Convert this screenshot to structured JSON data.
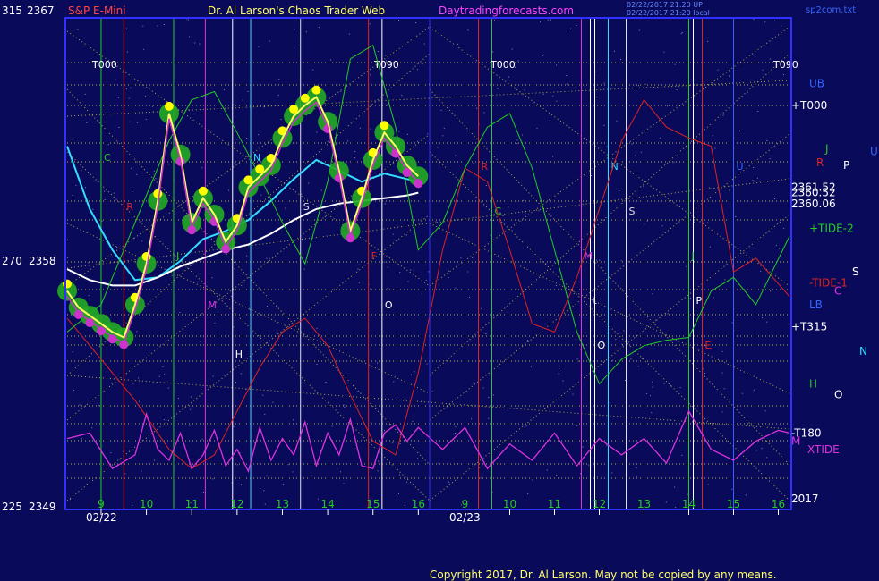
{
  "header": {
    "scale_top": "315",
    "price_top": "2367",
    "symbol": "S&P E-Mini",
    "title": "Dr. Al Larson's Chaos Trader Web",
    "site": "Daytradingforecasts.com",
    "stamp_1": "02/22/2017 21:20 UP",
    "stamp_2": "02/22/2017 21:20 local",
    "file": "sp2com.txt"
  },
  "left_axis": {
    "mid_scale": "270",
    "mid_price": "2358",
    "bottom_scale": "225",
    "bottom_price": "2349"
  },
  "footer": {
    "copyright": "Copyright 2017, Dr. Al Larson. May not be copied by any means."
  },
  "colors": {
    "background": "#0a0a5a",
    "frame": "#3030ff",
    "price_bar": "#ffff00",
    "price_bar_alt": "#cc33cc",
    "halo": "#22aa22",
    "fast_avg": "#ffff66",
    "cyan_avg": "#33ddff",
    "white_avg": "#ffffff",
    "red_flux": "#dd2222",
    "green_flux": "#22cc22",
    "xtide": "#dd33dd",
    "grid_dotted": "#dddd44"
  },
  "chart_data": {
    "type": "line",
    "title": "S&P E-Mini",
    "y_axis": {
      "min": 2349,
      "max": 2367,
      "labels": [
        "2367",
        "2358",
        "2349"
      ]
    },
    "x_axis": {
      "date_labels": [
        "02/22",
        "02/23"
      ],
      "hour_labels_day1": [
        "9",
        "10",
        "11",
        "12",
        "13",
        "14",
        "15",
        "16"
      ],
      "hour_labels_day2": [
        "9",
        "10",
        "11",
        "12",
        "13",
        "14",
        "15",
        "16"
      ],
      "hour_range": [
        8.25,
        16.25
      ]
    },
    "vertical_markers_day1": [
      {
        "label": "C",
        "hour": 9.0
      },
      {
        "label": "R",
        "hour": 9.5
      },
      {
        "label": "J",
        "hour": 10.6
      },
      {
        "label": "M",
        "hour": 11.3
      },
      {
        "label": "H",
        "hour": 11.9
      },
      {
        "label": "N",
        "hour": 12.3
      },
      {
        "label": "S",
        "hour": 13.4
      },
      {
        "label": "F",
        "hour": 14.9
      },
      {
        "label": "O",
        "hour": 15.2
      }
    ],
    "vertical_markers_day2": [
      {
        "label": "R",
        "hour": 9.3
      },
      {
        "label": "C",
        "hour": 9.6
      },
      {
        "label": "M",
        "hour": 11.6
      },
      {
        "label": "t",
        "hour": 11.8
      },
      {
        "label": "O",
        "hour": 11.9
      },
      {
        "label": "N",
        "hour": 12.2
      },
      {
        "label": "S",
        "hour": 12.6
      },
      {
        "label": "J",
        "hour": 14.0
      },
      {
        "label": "P",
        "hour": 14.1
      },
      {
        "label": "E",
        "hour": 14.3
      },
      {
        "label": "U",
        "hour": 15.0
      }
    ],
    "grid_labels": [
      "T000",
      "T090",
      "T000",
      "T090"
    ],
    "price_day1": {
      "hours": [
        8.25,
        8.5,
        8.75,
        9.0,
        9.25,
        9.5,
        9.75,
        10.0,
        10.25,
        10.5,
        10.75,
        11.0,
        11.25,
        11.5,
        11.75,
        12.0,
        12.25,
        12.5,
        12.75,
        13.0,
        13.25,
        13.5,
        13.75,
        14.0,
        14.25,
        14.5,
        14.75,
        15.0,
        15.25,
        15.5,
        15.75,
        16.0
      ],
      "values": [
        2357.0,
        2356.4,
        2356.1,
        2355.8,
        2355.5,
        2355.3,
        2356.5,
        2358.0,
        2360.3,
        2363.5,
        2362.0,
        2359.5,
        2360.4,
        2359.8,
        2358.8,
        2359.4,
        2360.8,
        2361.2,
        2361.6,
        2362.6,
        2363.4,
        2363.8,
        2364.1,
        2363.2,
        2361.4,
        2359.2,
        2360.4,
        2361.8,
        2362.8,
        2362.3,
        2361.6,
        2361.2
      ]
    },
    "series": [
      {
        "name": "cyan average",
        "hours": [
          8.25,
          8.75,
          9.25,
          9.75,
          10.25,
          10.75,
          11.25,
          11.75,
          12.25,
          12.75,
          13.25,
          13.75,
          14.25,
          14.75,
          15.25,
          15.75,
          16.0
        ],
        "values": [
          2362.3,
          2360.0,
          2358.5,
          2357.4,
          2357.5,
          2358.1,
          2358.9,
          2359.2,
          2359.6,
          2360.3,
          2361.1,
          2361.8,
          2361.4,
          2361.0,
          2361.3,
          2361.1,
          2361.0
        ]
      },
      {
        "name": "white average",
        "hours": [
          8.25,
          8.75,
          9.25,
          9.75,
          10.25,
          10.75,
          11.25,
          11.75,
          12.25,
          12.75,
          13.25,
          13.75,
          14.25,
          14.75,
          15.25,
          15.75,
          16.0
        ],
        "values": [
          2357.8,
          2357.4,
          2357.2,
          2357.2,
          2357.5,
          2357.9,
          2358.2,
          2358.5,
          2358.7,
          2359.1,
          2359.6,
          2360.0,
          2360.2,
          2360.3,
          2360.4,
          2360.5,
          2360.6
        ]
      },
      {
        "name": "red flux",
        "hours": [
          8.25,
          9.0,
          9.75,
          10.5,
          11.0,
          11.5,
          12.0,
          12.5,
          13.0,
          13.5,
          14.0,
          14.5,
          15.0,
          15.5,
          16.0,
          16.5,
          17.0,
          17.5,
          18.0,
          18.5,
          19.0,
          19.5,
          20.0,
          20.5,
          21.0,
          21.5,
          22.0,
          22.5,
          23.0,
          23.5,
          24.25
        ],
        "values": [
          2356.0,
          2354.5,
          2353.0,
          2351.2,
          2350.5,
          2351.0,
          2352.6,
          2354.2,
          2355.5,
          2356.0,
          2355.0,
          2353.2,
          2351.5,
          2351.0,
          2354.0,
          2358.5,
          2361.5,
          2361.0,
          2358.5,
          2355.8,
          2355.5,
          2357.5,
          2360.0,
          2362.5,
          2364.0,
          2363.0,
          2362.6,
          2362.3,
          2357.7,
          2358.2,
          2356.8
        ]
      },
      {
        "name": "green flux",
        "hours": [
          8.25,
          9.0,
          9.75,
          10.5,
          11.0,
          11.5,
          12.0,
          12.5,
          13.0,
          13.5,
          14.0,
          14.5,
          15.0,
          15.5,
          16.0,
          16.5,
          17.0,
          17.5,
          18.0,
          18.5,
          19.0,
          19.5,
          20.0,
          20.5,
          21.0,
          21.5,
          22.0,
          22.5,
          23.0,
          23.5,
          24.25
        ],
        "values": [
          2355.5,
          2356.5,
          2359.5,
          2362.5,
          2364.0,
          2364.3,
          2362.8,
          2361.2,
          2359.5,
          2358.0,
          2361.0,
          2365.5,
          2366.0,
          2363.0,
          2358.5,
          2359.5,
          2361.5,
          2363.0,
          2363.5,
          2361.5,
          2358.5,
          2355.5,
          2353.6,
          2354.5,
          2355.0,
          2355.2,
          2355.3,
          2357.0,
          2357.5,
          2356.5,
          2359.0
        ]
      },
      {
        "name": "XTIDE",
        "hours": [
          8.25,
          8.75,
          9.25,
          9.75,
          10.0,
          10.25,
          10.5,
          10.75,
          11.0,
          11.25,
          11.5,
          11.75,
          12.0,
          12.25,
          12.5,
          12.75,
          13.0,
          13.25,
          13.5,
          13.75,
          14.0,
          14.25,
          14.5,
          14.75,
          15.0,
          15.25,
          15.5,
          15.75,
          16.0,
          16.5,
          17.0,
          17.5,
          18.0,
          18.5,
          19.0,
          19.5,
          20.0,
          20.5,
          21.0,
          21.5,
          22.0,
          22.5,
          23.0,
          23.5,
          24.0,
          24.25
        ],
        "values": [
          2351.6,
          2351.8,
          2350.5,
          2351.0,
          2352.5,
          2351.2,
          2350.8,
          2351.8,
          2350.5,
          2351.0,
          2351.9,
          2350.6,
          2351.2,
          2350.4,
          2352.0,
          2350.8,
          2351.6,
          2351.0,
          2352.2,
          2350.6,
          2351.8,
          2351.0,
          2352.3,
          2350.6,
          2350.5,
          2351.8,
          2352.1,
          2351.5,
          2352.0,
          2351.2,
          2352.0,
          2350.5,
          2351.4,
          2350.8,
          2351.8,
          2350.6,
          2351.6,
          2351.0,
          2351.6,
          2350.7,
          2352.6,
          2351.2,
          2350.8,
          2351.5,
          2351.9,
          2351.8
        ]
      }
    ],
    "right_labels": [
      {
        "text": "UB",
        "price": 2364.6,
        "color": "#3366ff"
      },
      {
        "text": "+T000",
        "price": 2363.8,
        "color": "#ffffff"
      },
      {
        "text": "J",
        "price": 2362.2,
        "color": "#22cc22"
      },
      {
        "text": "U",
        "price": 2362.1,
        "color": "#3366ff"
      },
      {
        "text": "R",
        "price": 2361.7,
        "color": "#dd2222"
      },
      {
        "text": "P",
        "price": 2361.6,
        "color": "#ffffff"
      },
      {
        "text": "2361.52",
        "price": 2360.8,
        "color": "#ffffff"
      },
      {
        "text": "2360.52",
        "price": 2360.6,
        "color": "#ffffff"
      },
      {
        "text": "2360.06",
        "price": 2360.2,
        "color": "#ffffff"
      },
      {
        "text": "+TIDE-2",
        "price": 2359.3,
        "color": "#22cc22"
      },
      {
        "text": "S",
        "price": 2357.7,
        "color": "#ffffff"
      },
      {
        "text": "-TIDE-1",
        "price": 2357.3,
        "color": "#dd2222"
      },
      {
        "text": "C",
        "price": 2357.0,
        "color": "#dd33dd"
      },
      {
        "text": "LB",
        "price": 2356.5,
        "color": "#3366ff"
      },
      {
        "text": "+T315",
        "price": 2355.7,
        "color": "#ffffff"
      },
      {
        "text": "N",
        "price": 2354.8,
        "color": "#33ddff"
      },
      {
        "text": "H",
        "price": 2353.6,
        "color": "#22cc22"
      },
      {
        "text": "O",
        "price": 2353.2,
        "color": "#ffffff"
      },
      {
        "text": "-T180",
        "price": 2351.8,
        "color": "#ffffff"
      },
      {
        "text": "M",
        "price": 2351.5,
        "color": "#dd33dd"
      },
      {
        "text": "XTIDE",
        "price": 2351.2,
        "color": "#dd33dd"
      },
      {
        "text": "2017",
        "price": 2349.4,
        "color": "#ffffff"
      }
    ]
  }
}
